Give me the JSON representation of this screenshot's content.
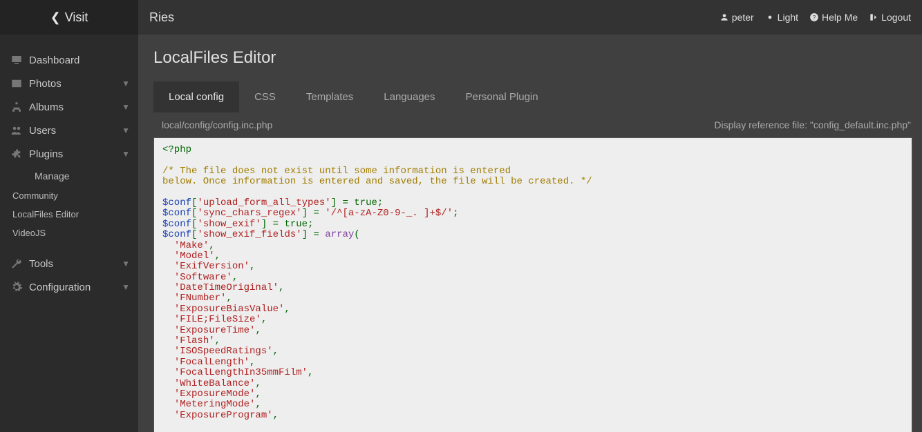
{
  "visit_label": "Visit",
  "topbar": {
    "title": "Ries",
    "user": "peter",
    "theme": "Light",
    "help": "Help Me",
    "logout": "Logout"
  },
  "sidebar": {
    "items": [
      {
        "label": "Dashboard",
        "expandable": false
      },
      {
        "label": "Photos",
        "expandable": true
      },
      {
        "label": "Albums",
        "expandable": true
      },
      {
        "label": "Users",
        "expandable": true
      },
      {
        "label": "Plugins",
        "expandable": true
      }
    ],
    "plugin_sub": [
      {
        "label": "Manage",
        "icon": true
      },
      {
        "label": "Community"
      },
      {
        "label": "LocalFiles Editor"
      },
      {
        "label": "VideoJS"
      }
    ],
    "items2": [
      {
        "label": "Tools",
        "expandable": true
      },
      {
        "label": "Configuration",
        "expandable": true
      }
    ]
  },
  "page": {
    "title": "LocalFiles Editor"
  },
  "tabs": [
    {
      "label": "Local config",
      "active": true
    },
    {
      "label": "CSS"
    },
    {
      "label": "Templates"
    },
    {
      "label": "Languages"
    },
    {
      "label": "Personal Plugin"
    }
  ],
  "filebar": {
    "path": "local/config/config.inc.php",
    "ref": "Display reference file: \"config_default.inc.php\""
  },
  "code": {
    "open_tag": "<?php",
    "comment_l1": "/* The file does not exist until some information is entered",
    "comment_l2": "below. Once information is entered and saved, the file will be created. */",
    "var": "$conf",
    "k1": "'upload_form_all_types'",
    "v1": "true",
    "k2": "'sync_chars_regex'",
    "v2": "'/^[a-zA-Z0-9-_. ]+$/'",
    "k3": "'show_exif'",
    "v3": "true",
    "k4": "'show_exif_fields'",
    "array_kw": "array",
    "fields": [
      "'Make'",
      "'Model'",
      "'ExifVersion'",
      "'Software'",
      "'DateTimeOriginal'",
      "'FNumber'",
      "'ExposureBiasValue'",
      "'FILE;FileSize'",
      "'ExposureTime'",
      "'Flash'",
      "'ISOSpeedRatings'",
      "'FocalLength'",
      "'FocalLengthIn35mmFilm'",
      "'WhiteBalance'",
      "'ExposureMode'",
      "'MeteringMode'",
      "'ExposureProgram'"
    ]
  }
}
